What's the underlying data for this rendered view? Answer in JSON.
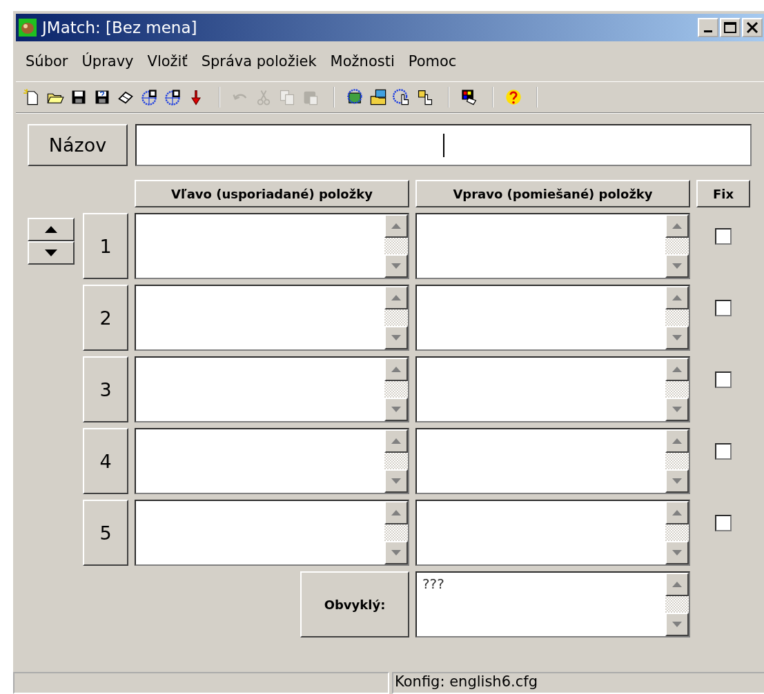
{
  "window": {
    "title": "JMatch: [Bez mena]"
  },
  "menu": [
    {
      "label": "Súbor"
    },
    {
      "label": "Úpravy"
    },
    {
      "label": "Vložiť"
    },
    {
      "label": "Správa položiek"
    },
    {
      "label": "Možnosti"
    },
    {
      "label": "Pomoc"
    }
  ],
  "toolbar": [
    [
      {
        "kind": "new",
        "disabled": false
      },
      {
        "kind": "open",
        "disabled": false
      },
      {
        "kind": "save",
        "disabled": false
      },
      {
        "kind": "save-as",
        "disabled": false
      },
      {
        "kind": "eraser",
        "disabled": false
      },
      {
        "kind": "web-six",
        "disabled": false
      },
      {
        "kind": "web-six-clock",
        "disabled": false
      },
      {
        "kind": "arrow-down",
        "disabled": false
      }
    ],
    [
      {
        "kind": "undo",
        "disabled": true
      },
      {
        "kind": "cut",
        "disabled": true
      },
      {
        "kind": "copy",
        "disabled": true
      },
      {
        "kind": "paste",
        "disabled": true
      }
    ],
    [
      {
        "kind": "web-image",
        "disabled": false
      },
      {
        "kind": "web-folder",
        "disabled": false
      },
      {
        "kind": "web-hand",
        "disabled": false
      },
      {
        "kind": "hand",
        "disabled": false
      }
    ],
    [
      {
        "kind": "palette",
        "disabled": false
      }
    ],
    [
      {
        "kind": "help",
        "disabled": false
      }
    ]
  ],
  "title_field": {
    "label": "Názov"
  },
  "columns": [
    {
      "label": "Vľavo (usporiadané) položky"
    },
    {
      "label": "Vpravo (pomiešané) položky"
    },
    {
      "label": "Fix"
    }
  ],
  "rows": [
    {
      "number": "1",
      "fix": false
    },
    {
      "number": "2",
      "fix": false
    },
    {
      "number": "3",
      "fix": false
    },
    {
      "number": "4",
      "fix": false
    },
    {
      "number": "5",
      "fix": false
    }
  ],
  "default": {
    "label": "Obvyklý:",
    "value": "???"
  },
  "status_bar": {
    "text": "Konfig: english6.cfg"
  }
}
